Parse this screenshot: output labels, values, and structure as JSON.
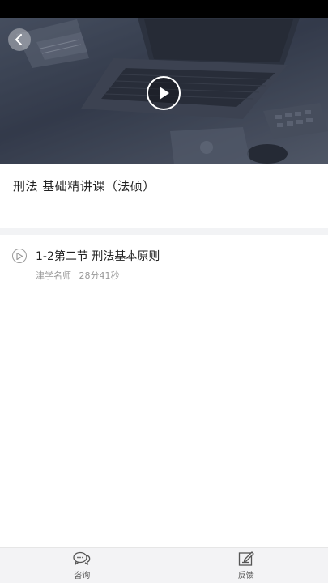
{
  "course": {
    "title": "刑法 基础精讲课（法硕）"
  },
  "lessons": [
    {
      "title": "1-2第二节 刑法基本原则",
      "teacher": "津学名师",
      "duration": "28分41秒"
    }
  ],
  "tabbar": {
    "consult_label": "咨询",
    "feedback_label": "反馈"
  },
  "icons": {
    "back": "chevron-left-icon",
    "play": "play-icon",
    "lesson": "play-circle-icon",
    "consult": "chat-bubbles-icon",
    "feedback": "edit-note-icon"
  },
  "colors": {
    "divider": "#f2f3f5",
    "tabbar": "#f3f3f5"
  }
}
